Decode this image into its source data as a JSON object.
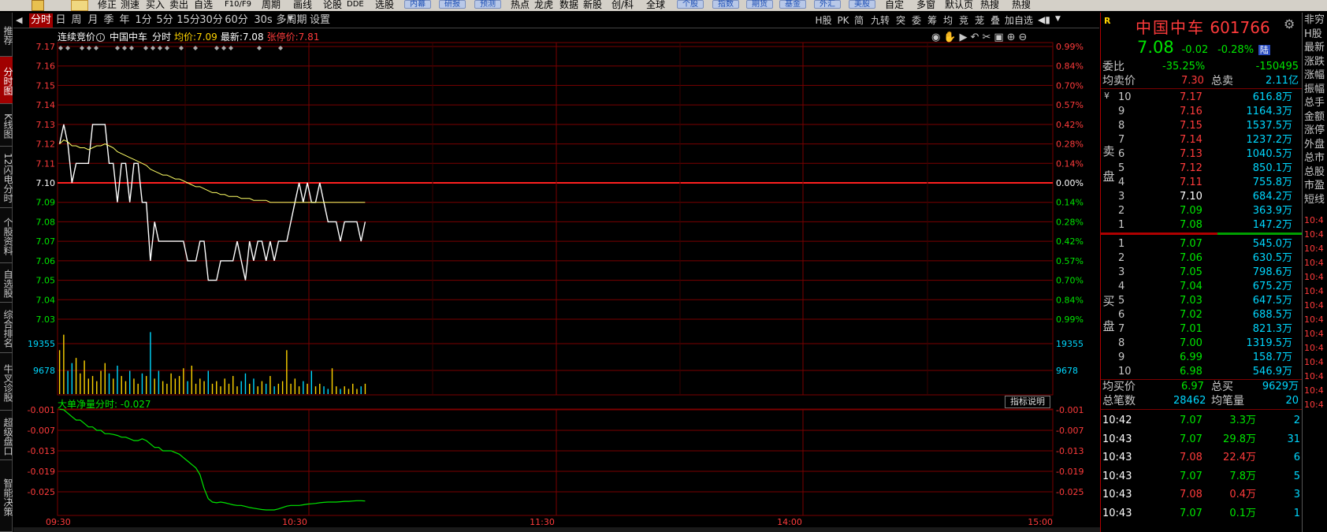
{
  "topbar": {
    "items": [
      "修正",
      "测速",
      "买入",
      "卖出",
      "自选",
      "F10/F9",
      "周期",
      "画线",
      "论股",
      "DDE",
      "选股",
      "内幕",
      "研报",
      "预测",
      "热点",
      "龙虎",
      "数据",
      "新股",
      "创/科",
      "全球",
      "个股",
      "指数",
      "期货",
      "基金",
      "外汇",
      "美股",
      "自定",
      "多窗",
      "默认页",
      "热搜",
      "热搜"
    ]
  },
  "leftnav": {
    "items": [
      "推荐",
      "分时图",
      "K线图",
      "12闪电分时",
      "个股资料",
      "自选股",
      "综合排名",
      "牛叉诊股",
      "超级盘口",
      "智能决策"
    ]
  },
  "tabs": {
    "left": [
      "分时",
      "日",
      "周",
      "月",
      "季",
      "年",
      "1分",
      "5分",
      "15分",
      "30分",
      "60分",
      "30s",
      "多周期",
      "设置"
    ],
    "right": [
      "H股",
      "PK",
      "简",
      "九转",
      "突",
      "委",
      "筹",
      "均",
      "竞",
      "茏",
      "叠",
      "加自选"
    ]
  },
  "info": {
    "auction": "连续竞价",
    "name": "中国中车",
    "mode": "分时",
    "avg_label": "均价:",
    "avg": "7.09",
    "last_label": "最新:",
    "last": "7.08",
    "limit_label": "张停价:",
    "limit": "7.81"
  },
  "indicator": {
    "label": "大单净量分时:",
    "value": "-0.027",
    "help": "指标说明"
  },
  "chart_data": [
    {
      "type": "line",
      "title": "中国中车 分时",
      "y_left_ticks": [
        "7.17",
        "7.16",
        "7.15",
        "7.14",
        "7.13",
        "7.12",
        "7.11",
        "7.10",
        "7.09",
        "7.08",
        "7.07",
        "7.06",
        "7.05",
        "7.04",
        "7.03"
      ],
      "y_right_ticks": [
        "0.99%",
        "0.84%",
        "0.70%",
        "0.57%",
        "0.42%",
        "0.28%",
        "0.14%",
        "0.00%",
        "0.14%",
        "0.28%",
        "0.42%",
        "0.57%",
        "0.70%",
        "0.84%",
        "0.99%"
      ],
      "x_ticks": [
        "09:30",
        "10:30",
        "11:30",
        "14:00",
        "15:00"
      ],
      "ylim": [
        7.03,
        7.17
      ],
      "prev_close": 7.1,
      "series": [
        {
          "name": "价格",
          "color": "#ffffff",
          "values": [
            7.12,
            7.13,
            7.12,
            7.1,
            7.11,
            7.11,
            7.11,
            7.11,
            7.13,
            7.13,
            7.13,
            7.13,
            7.11,
            7.11,
            7.09,
            7.11,
            7.11,
            7.09,
            7.11,
            7.11,
            7.09,
            7.09,
            7.06,
            7.08,
            7.07,
            7.07,
            7.07,
            7.07,
            7.07,
            7.07,
            7.07,
            7.06,
            7.06,
            7.06,
            7.07,
            7.07,
            7.05,
            7.05,
            7.05,
            7.06,
            7.06,
            7.06,
            7.06,
            7.07,
            7.06,
            7.05,
            7.07,
            7.06,
            7.07,
            7.07,
            7.06,
            7.07,
            7.06,
            7.07,
            7.07,
            7.07,
            7.08,
            7.09,
            7.1,
            7.09,
            7.1,
            7.09,
            7.09,
            7.1,
            7.09,
            7.08,
            7.08,
            7.08,
            7.07,
            7.08,
            7.08,
            7.08,
            7.08,
            7.07,
            7.08
          ]
        },
        {
          "name": "均价",
          "color": "#ffff66",
          "values": [
            7.12,
            7.122,
            7.121,
            7.119,
            7.119,
            7.118,
            7.118,
            7.117,
            7.118,
            7.119,
            7.119,
            7.12,
            7.119,
            7.118,
            7.116,
            7.115,
            7.114,
            7.113,
            7.112,
            7.111,
            7.11,
            7.109,
            7.107,
            7.106,
            7.105,
            7.104,
            7.104,
            7.103,
            7.102,
            7.102,
            7.101,
            7.1,
            7.099,
            7.098,
            7.098,
            7.097,
            7.096,
            7.095,
            7.095,
            7.094,
            7.094,
            7.093,
            7.093,
            7.093,
            7.092,
            7.092,
            7.092,
            7.091,
            7.091,
            7.091,
            7.091,
            7.09,
            7.09,
            7.09,
            7.09,
            7.09,
            7.09,
            7.09,
            7.09,
            7.09,
            7.09,
            7.09,
            7.09,
            7.09,
            7.09,
            7.09,
            7.09,
            7.09,
            7.09,
            7.09,
            7.09,
            7.09,
            7.09,
            7.09,
            7.09
          ]
        }
      ],
      "volume": {
        "ticks": [
          "19355",
          "9678"
        ],
        "max": 29000,
        "values": [
          17000,
          23000,
          9000,
          12000,
          14000,
          8000,
          13000,
          6000,
          7000,
          5000,
          9000,
          12000,
          8000,
          6000,
          11000,
          7000,
          5000,
          9000,
          6000,
          4000,
          8000,
          7000,
          24000,
          6000,
          9000,
          5000,
          4000,
          8000,
          6000,
          7000,
          10000,
          5000,
          11000,
          4000,
          6000,
          5000,
          9000,
          4000,
          5000,
          3000,
          6000,
          4000,
          7000,
          3000,
          5000,
          8000,
          4000,
          6000,
          3000,
          5000,
          4000,
          7000,
          3000,
          4000,
          5000,
          17000,
          4000,
          6000,
          3000,
          5000,
          4000,
          9000,
          3000,
          4000,
          3000,
          2000,
          10000,
          3000,
          2000,
          3000,
          2000,
          4000,
          2000,
          3000,
          4000
        ]
      }
    },
    {
      "type": "line",
      "title": "大单净量分时",
      "y_ticks": [
        "-0.001",
        "-0.007",
        "-0.013",
        "-0.019",
        "-0.025"
      ],
      "ylim": [
        -0.031,
        -0.001
      ],
      "series": [
        {
          "name": "大单净量",
          "color": "#00e600",
          "values": [
            -0.0008,
            -0.001,
            -0.002,
            -0.003,
            -0.004,
            -0.004,
            -0.005,
            -0.006,
            -0.006,
            -0.007,
            -0.007,
            -0.008,
            -0.008,
            -0.0082,
            -0.0085,
            -0.009,
            -0.009,
            -0.0095,
            -0.01,
            -0.01,
            -0.0095,
            -0.01,
            -0.011,
            -0.012,
            -0.012,
            -0.013,
            -0.013,
            -0.013,
            -0.0135,
            -0.014,
            -0.015,
            -0.016,
            -0.017,
            -0.018,
            -0.02,
            -0.024,
            -0.027,
            -0.028,
            -0.0282,
            -0.028,
            -0.0282,
            -0.0285,
            -0.0288,
            -0.029,
            -0.029,
            -0.0293,
            -0.0296,
            -0.0298,
            -0.03,
            -0.0302,
            -0.0303,
            -0.0303,
            -0.0303,
            -0.03,
            -0.0296,
            -0.0292,
            -0.029,
            -0.029,
            -0.029,
            -0.0288,
            -0.0286,
            -0.0285,
            -0.0284,
            -0.0282,
            -0.0281,
            -0.028,
            -0.028,
            -0.028,
            -0.0279,
            -0.0278,
            -0.0278,
            -0.0277,
            -0.0276,
            -0.0276,
            -0.0277
          ]
        }
      ]
    }
  ],
  "quote": {
    "stock_name": "中国中车",
    "code": "601766",
    "price": "7.08",
    "change": "-0.02",
    "change_pct": "-0.28%",
    "badge": "陆",
    "weibi_label": "委比",
    "weibi": "-35.25%",
    "weicha": "-150495",
    "avg_sell_label": "均卖价",
    "avg_sell": "7.30",
    "total_sell_label": "总卖",
    "total_sell": "2.11亿",
    "sell_label": "卖盘",
    "buy_label": "买盘",
    "asks": [
      {
        "lvl": "10",
        "price": "7.17",
        "vol": "616.8万"
      },
      {
        "lvl": "9",
        "price": "7.16",
        "vol": "1164.3万"
      },
      {
        "lvl": "8",
        "price": "7.15",
        "vol": "1537.5万"
      },
      {
        "lvl": "7",
        "price": "7.14",
        "vol": "1237.2万"
      },
      {
        "lvl": "6",
        "price": "7.13",
        "vol": "1040.5万"
      },
      {
        "lvl": "5",
        "price": "7.12",
        "vol": "850.1万"
      },
      {
        "lvl": "4",
        "price": "7.11",
        "vol": "755.8万"
      },
      {
        "lvl": "3",
        "price": "7.10",
        "vol": "684.2万"
      },
      {
        "lvl": "2",
        "price": "7.09",
        "vol": "363.9万"
      },
      {
        "lvl": "1",
        "price": "7.08",
        "vol": "147.2万"
      }
    ],
    "bids": [
      {
        "lvl": "1",
        "price": "7.07",
        "vol": "545.0万"
      },
      {
        "lvl": "2",
        "price": "7.06",
        "vol": "630.5万"
      },
      {
        "lvl": "3",
        "price": "7.05",
        "vol": "798.6万"
      },
      {
        "lvl": "4",
        "price": "7.04",
        "vol": "675.2万"
      },
      {
        "lvl": "5",
        "price": "7.03",
        "vol": "647.5万"
      },
      {
        "lvl": "6",
        "price": "7.02",
        "vol": "688.5万"
      },
      {
        "lvl": "7",
        "price": "7.01",
        "vol": "821.3万"
      },
      {
        "lvl": "8",
        "price": "7.00",
        "vol": "1319.5万"
      },
      {
        "lvl": "9",
        "price": "6.99",
        "vol": "158.7万"
      },
      {
        "lvl": "10",
        "price": "6.98",
        "vol": "546.9万"
      }
    ],
    "avg_buy_label": "均买价",
    "avg_buy": "6.97",
    "total_buy_label": "总买",
    "total_buy": "9629万",
    "deals_label": "总笔数",
    "deals": "28462",
    "avg_vol_label": "均笔量",
    "avg_vol": "20",
    "ticks": [
      {
        "time": "10:42",
        "price": "7.07",
        "vol": "3.3万",
        "n": "2"
      },
      {
        "time": "10:43",
        "price": "7.07",
        "vol": "29.8万",
        "n": "31"
      },
      {
        "time": "10:43",
        "price": "7.08",
        "vol": "22.4万",
        "n": "6"
      },
      {
        "time": "10:43",
        "price": "7.07",
        "vol": "7.8万",
        "n": "5"
      },
      {
        "time": "10:43",
        "price": "7.08",
        "vol": "0.4万",
        "n": "3"
      },
      {
        "time": "10:43",
        "price": "7.07",
        "vol": "0.1万",
        "n": "1"
      }
    ]
  },
  "farright": {
    "labels": [
      "非穷",
      "H股",
      "最新",
      "涨跌",
      "涨幅",
      "振幅",
      "总手",
      "金额",
      "涨停",
      "外盘",
      "总市",
      "总股",
      "市盈",
      "短线"
    ],
    "times": [
      "10:4",
      "10:4",
      "10:4",
      "10:4",
      "10:4",
      "10:4",
      "10:4",
      "10:4",
      "10:4",
      "10:4",
      "10:4",
      "10:4",
      "10:4",
      "10:4"
    ]
  },
  "colors": {
    "up": "#ff3b3b",
    "down": "#00e600",
    "grid": "#7a0000",
    "price": "#ffffff",
    "avg": "#ffff66"
  }
}
